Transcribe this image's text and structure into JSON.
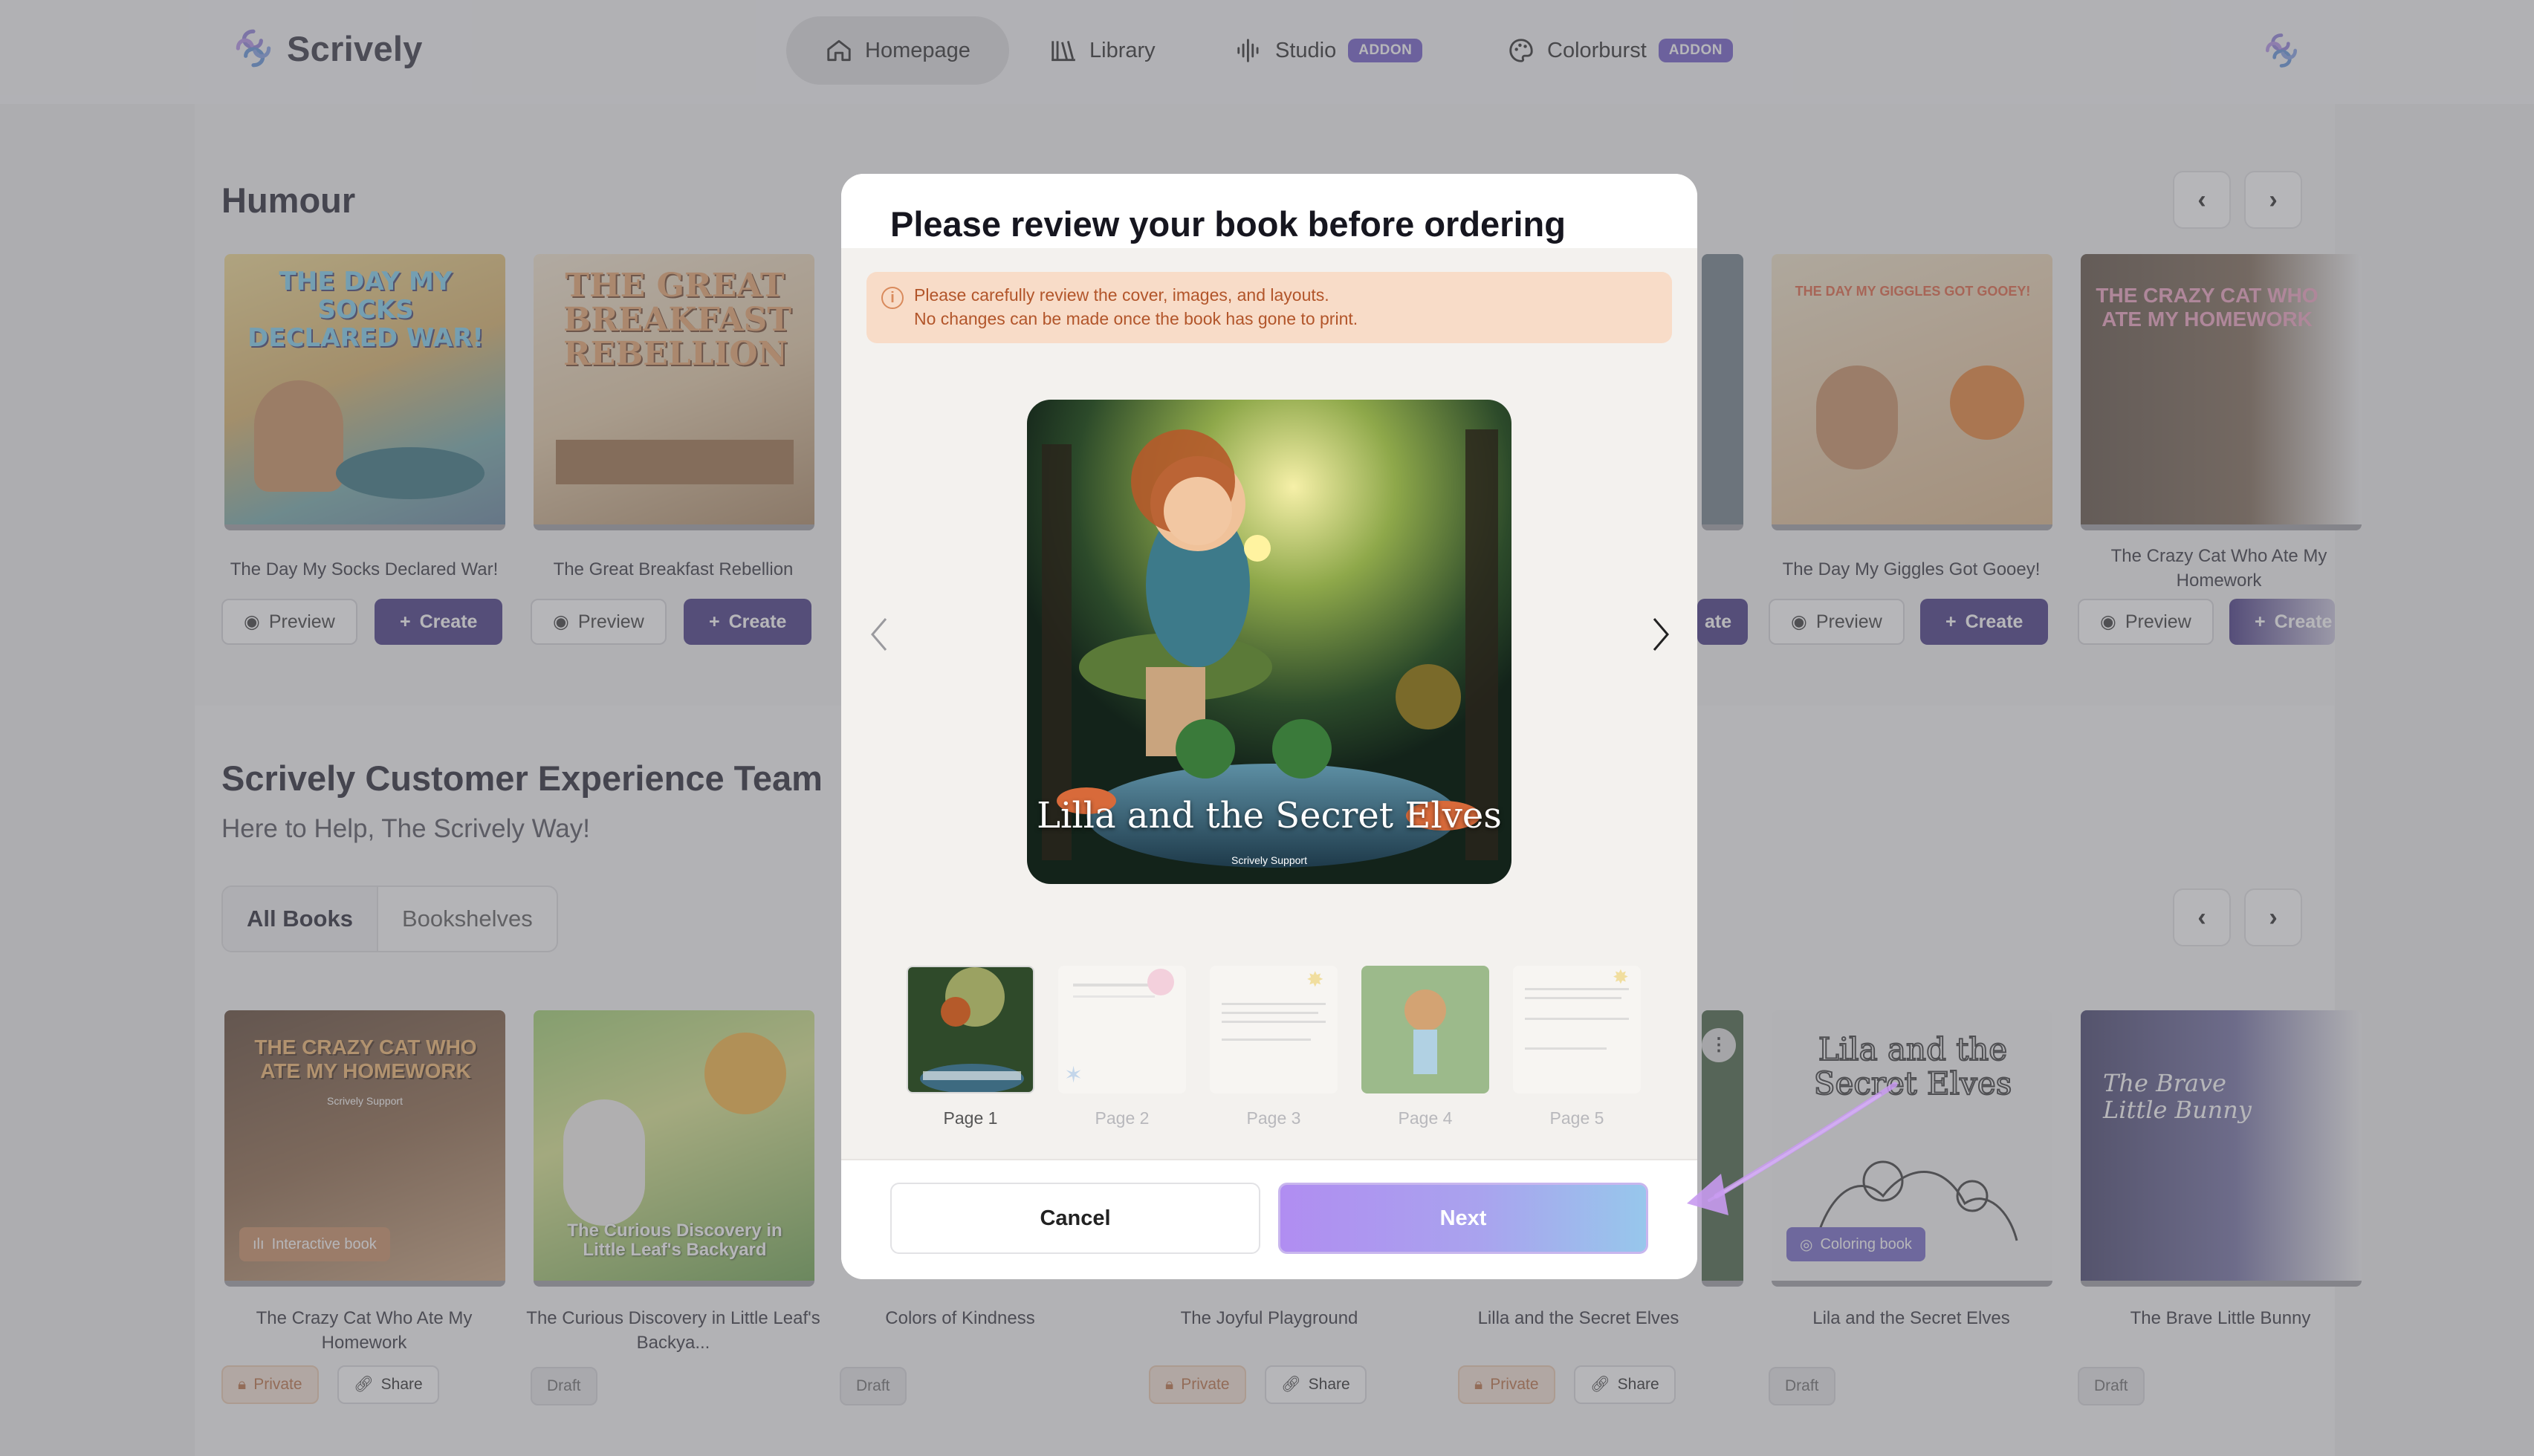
{
  "app": {
    "name": "Scrively"
  },
  "nav": {
    "items": [
      {
        "label": "Homepage",
        "icon": "home-icon",
        "active": true
      },
      {
        "label": "Library",
        "icon": "library-icon"
      },
      {
        "label": "Studio",
        "icon": "waveform-icon",
        "badge": "ADDON"
      },
      {
        "label": "Colorburst",
        "icon": "palette-icon",
        "badge": "ADDON"
      }
    ]
  },
  "humour": {
    "title": "Humour",
    "books": [
      {
        "title": "The Day My Socks Declared War!",
        "preview": "Preview",
        "create": "Create"
      },
      {
        "title": "The Great Breakfast Rebellion",
        "preview": "Preview",
        "create": "Create"
      },
      {
        "title": "The Day My Giggles Got Gooey!",
        "preview": "Preview",
        "create": "Create"
      },
      {
        "title": "The Crazy Cat Who Ate My Homework",
        "preview": "Preview",
        "create": "Create"
      }
    ],
    "partial_create": "ate",
    "cover_text": {
      "socks": "THE DAY MY SOCKS DECLARED WAR!",
      "breakfast": "THE GREAT BREAKFAST REBELLION",
      "giggles": "THE DAY MY GIGGLES GOT GOOEY!",
      "crazycat": "THE CRAZY CAT WHO ATE MY HOMEWORK"
    }
  },
  "team": {
    "title": "Scrively Customer Experience Team",
    "subtitle": "Here to Help, The Scrively Way!",
    "tabs": [
      "All Books",
      "Bookshelves"
    ],
    "books": [
      {
        "title": "The Crazy Cat Who Ate My Homework",
        "tag": "Interactive book",
        "status": "Private",
        "share": "Share",
        "cover_text": "THE CRAZY CAT WHO ATE MY HOMEWORK",
        "cover_author": "Scrively Support"
      },
      {
        "title": "The Curious Discovery in Little Leaf's Backya...",
        "status": "Draft",
        "cover_text": "The Curious Discovery in Little Leaf's Backyard"
      },
      {
        "title": "Colors of Kindness",
        "status": "Draft"
      },
      {
        "title": "The Joyful Playground",
        "status": "Private",
        "share": "Share"
      },
      {
        "title": "Lilla and the Secret Elves",
        "status": "Private",
        "share": "Share"
      },
      {
        "title": "Lila and the Secret Elves",
        "tag": "Coloring book",
        "status": "Draft",
        "cover_text": "Lila and the Secret Elves"
      },
      {
        "title": "The Brave Little Bunny",
        "status": "Draft",
        "cover_text": "The Brave Little Bunny"
      }
    ]
  },
  "modal": {
    "title": "Please review your book before ordering",
    "warning_line1": "Please carefully review the cover, images, and layouts.",
    "warning_line2": "No changes can be made once the book has gone to print.",
    "cover_title": "Lilla and the Secret Elves",
    "cover_author": "Scrively Support",
    "pages": [
      "Page 1",
      "Page 2",
      "Page 3",
      "Page 4",
      "Page 5"
    ],
    "cancel": "Cancel",
    "next": "Next"
  },
  "colors": {
    "brand": "#6b55c6",
    "create_button": "#3d2e7e",
    "warning_bg": "#f8dcc8",
    "warning_text": "#b2552a"
  }
}
